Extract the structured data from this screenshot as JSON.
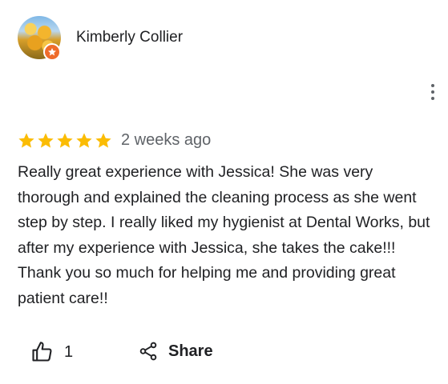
{
  "reviewer": {
    "name": "Kimberly Collier",
    "avatar_icon": "tulip-photo-avatar",
    "badge_icon": "local-guide-star-icon",
    "badge_color": "#ef6c2b"
  },
  "menu": {
    "icon": "more-vert-icon"
  },
  "rating": {
    "stars": 5,
    "max": 5,
    "star_color": "#fbbc04"
  },
  "review": {
    "date": "2 weeks ago",
    "text": "Really great experience with Jessica! She was very thorough and explained the cleaning process as she went step by step. I really liked my hygienist at Dental Works, but after my experience with Jessica,  she takes the cake!!! Thank you so much for helping me and providing great patient care!!"
  },
  "actions": {
    "like": {
      "icon": "thumb-up-icon",
      "count": "1"
    },
    "share": {
      "icon": "share-icon",
      "label": "Share"
    }
  }
}
